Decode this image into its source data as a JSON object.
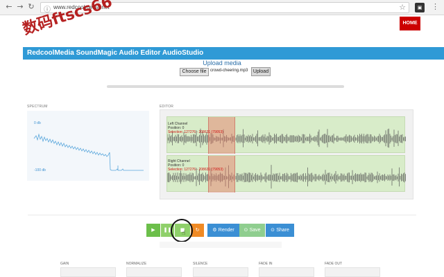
{
  "browser": {
    "url": "www.redcoolmedia.net",
    "back_icon": "arrow-left",
    "forward_icon": "arrow-right",
    "reload_icon": "reload",
    "info_icon": "info",
    "star_icon": "star",
    "menu_icon": "vertical-dots"
  },
  "header": {
    "home_label": "HOME",
    "watermark": "数码ftscs66",
    "title": "RedcoolMedia SoundMagic Audio Editor AudioStudio"
  },
  "upload": {
    "heading": "Upload media",
    "choose_label": "Choose file",
    "file_name": "crowd-cheering.mp3",
    "upload_label": "Upload"
  },
  "spectrum": {
    "label": "SPECTRUM",
    "top_db": "0 db",
    "bottom_db": "-100 db"
  },
  "editor": {
    "label": "EDITOR",
    "left": {
      "name": "Left Channel",
      "position": "Position: 0",
      "selection": "Selection: 127276 - 208631 (79053)"
    },
    "right": {
      "name": "Right Channel",
      "position": "Position: 0",
      "selection": "Selection: 127276 - 208631 (79053)"
    }
  },
  "controls": {
    "play_icon": "play",
    "pause_icon": "pause",
    "stop_icon": "stop",
    "loop_icon": "loop",
    "render_label": "Render",
    "save_label": "Save",
    "share_label": "Share"
  },
  "effects": {
    "gain": "GAIN",
    "normalize": "NORMALIZE",
    "silence": "SILENCE",
    "fade_in": "FADE IN",
    "fade_out": "FADE OUT"
  },
  "colors": {
    "title_bar": "#2f9ad6",
    "home": "#cc0000",
    "channel_bg": "#d8ecc9",
    "selection": "#e87864",
    "play": "#6cbf4a",
    "loop": "#f08a24",
    "render": "#3b8fd4"
  }
}
